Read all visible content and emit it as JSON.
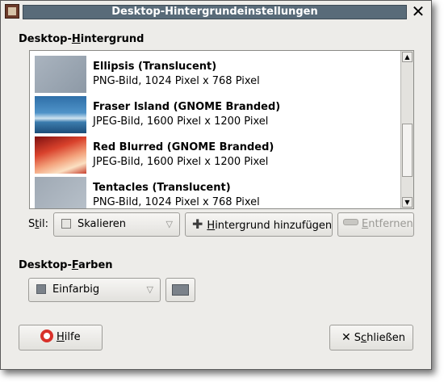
{
  "window": {
    "title": "Desktop-Hintergrundeinstellungen"
  },
  "section_background": {
    "label_pre": "Desktop-",
    "label_u": "H",
    "label_post": "intergrund"
  },
  "wallpapers": [
    {
      "title": "Ellipsis (Translucent)",
      "info": "PNG-Bild, 1024 Pixel x 768 Pixel"
    },
    {
      "title": "Fraser Island (GNOME Branded)",
      "info": "JPEG-Bild, 1600 Pixel x 1200 Pixel"
    },
    {
      "title": "Red Blurred (GNOME Branded)",
      "info": "JPEG-Bild, 1600 Pixel x 1200 Pixel"
    },
    {
      "title": "Tentacles (Translucent)",
      "info": "PNG-Bild, 1024 Pixel x 768 Pixel"
    }
  ],
  "style_control": {
    "label_pre": "S",
    "label_u": "t",
    "label_post": "il:",
    "value": "Skalieren"
  },
  "add_button": {
    "label_u": "H",
    "label_post": "intergrund hinzufügen",
    "icon": "plus-icon"
  },
  "remove_button": {
    "label_u": "E",
    "label_post": "ntfernen",
    "icon": "remove-icon"
  },
  "section_colors": {
    "label_pre": "Desktop-",
    "label_u": "F",
    "label_post": "arben"
  },
  "color_mode": {
    "value": "Einfarbig"
  },
  "color_swatch": {
    "color": "#7b828a"
  },
  "help_button": {
    "label_u": "H",
    "label_post": "ilfe",
    "icon": "lifebuoy-icon"
  },
  "close_button": {
    "label_pre": "S",
    "label_u": "c",
    "label_post": "hließen",
    "icon": "close-x-icon"
  },
  "colors": {
    "title_bar": "#596b79",
    "window_bg": "#edece9",
    "swatch": "#7b828a"
  }
}
